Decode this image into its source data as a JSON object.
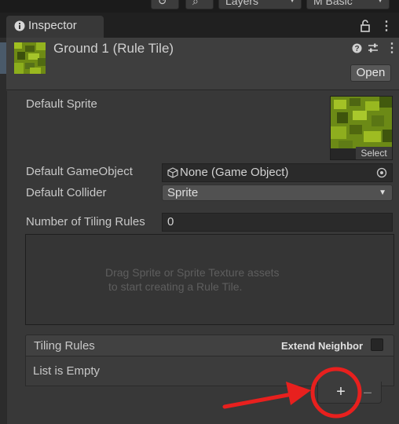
{
  "toolbar": {
    "layers_label": "Layers",
    "layout_label": "M Basic"
  },
  "tab": {
    "label": "Inspector"
  },
  "asset": {
    "title": "Ground 1 (Rule Tile)",
    "open_label": "Open"
  },
  "fields": {
    "default_sprite_label": "Default Sprite",
    "select_label": "Select",
    "default_gameobject_label": "Default GameObject",
    "default_gameobject_value": "None (Game Object)",
    "default_collider_label": "Default Collider",
    "default_collider_value": "Sprite",
    "tiling_rules_count_label": "Number of Tiling Rules",
    "tiling_rules_count_value": "0"
  },
  "dropzone": {
    "line1": "Drag Sprite or Sprite Texture assets",
    "line2": "to start creating a Rule Tile."
  },
  "rules": {
    "header": "Tiling Rules",
    "extend_neighbor_label": "Extend Neighbor",
    "empty_text": "List is Empty",
    "add_label": "+",
    "remove_label": "–"
  },
  "colors": {
    "annotation_red": "#e8201e",
    "panel_bg": "#383838",
    "tile_green": "#8aa81c"
  },
  "icons": [
    "history-icon",
    "search-icon",
    "info-icon",
    "lock-icon",
    "kebab-menu-icon",
    "help-icon",
    "presets-icon",
    "gameobject-cube-icon",
    "object-picker-icon",
    "dropdown-arrow-icon"
  ]
}
